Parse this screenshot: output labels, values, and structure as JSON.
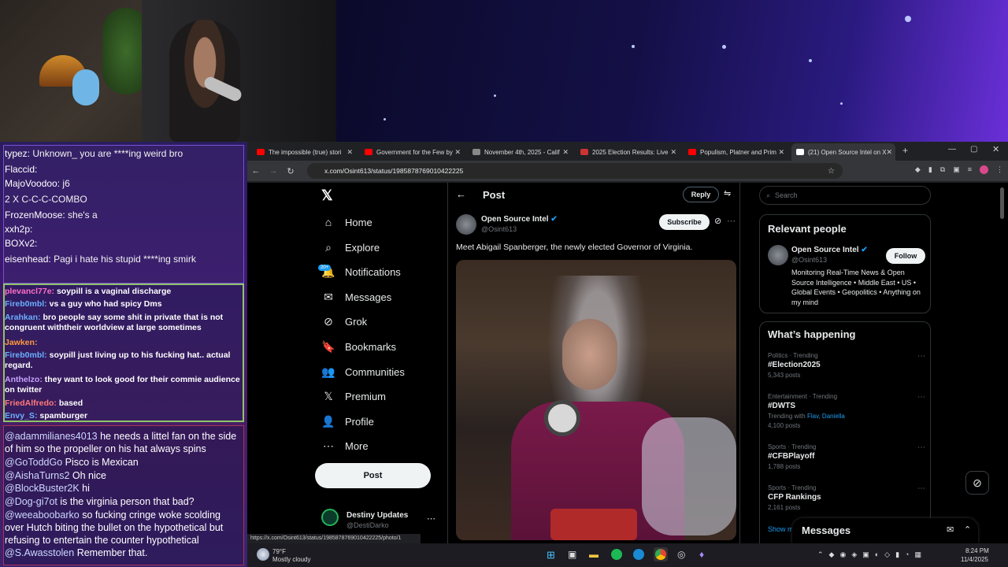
{
  "chat": {
    "top_lines": [
      {
        "user": "typez:",
        "text": "Unknown_ you are ****ing weird bro"
      },
      {
        "user": "Flaccid:",
        "text": ""
      },
      {
        "user": "MajoVoodoo:",
        "text": "j6"
      },
      {
        "user": "",
        "text": "2 X  C-C-C-COMBO"
      },
      {
        "user": "FrozenMoose:",
        "text": "she's a"
      },
      {
        "user": "xxh2p:",
        "text": ""
      },
      {
        "user": "BOXv2:",
        "text": ""
      },
      {
        "user": "eisenhead:",
        "text": "Pagi i hate his stupid ****ing smirk"
      }
    ],
    "mid_lines": [
      {
        "user": "plevancl77e:",
        "text": "soypill is a vaginal discharge"
      },
      {
        "user": "Fireb0mbl:",
        "text": "vs a guy who had spicy Dms"
      },
      {
        "user": "Arahkan:",
        "text": "bro people say some shit in private that is not congruent withtheir worldview at large sometimes"
      },
      {
        "user": "Jawken:",
        "text": ""
      },
      {
        "user": "Fireb0mbl:",
        "text": "soypill just living up to his fucking hat.. actual regard."
      },
      {
        "user": "Anthelzo:",
        "text": "they want to look good for their commie audience on twitter"
      },
      {
        "user": "FriedAlfredo:",
        "text": "based"
      },
      {
        "user": "Envy_S:",
        "text": "spamburger"
      }
    ],
    "bottom_lines": [
      {
        "user": "@adammilianes4013",
        "text": "he needs a littel fan on the side of him so the propeller on his hat always spins"
      },
      {
        "user": "@GoToddGo",
        "text": "Pisco is Mexican"
      },
      {
        "user": "@AishaTurns2",
        "text": "Oh nice"
      },
      {
        "user": "@BlockBuster2K",
        "text": "hi"
      },
      {
        "user": "@Dog-gi7ot",
        "text": "is the virginia person that bad?"
      },
      {
        "user": "@weeaboobarko",
        "text": "so fucking cringe woke scolding over Hutch biting the bullet on the hypothetical but refusing to entertain the counter hypothetical"
      },
      {
        "user": "@S.Awasstolen",
        "text": "Remember that."
      }
    ]
  },
  "browser": {
    "tabs": [
      {
        "label": "The impossible (true) stori",
        "color": "#ff0000"
      },
      {
        "label": "Government for the Few by",
        "color": "#ff0000"
      },
      {
        "label": "November 4th, 2025 - Calif",
        "color": "#888888"
      },
      {
        "label": "2025 Election Results: Live",
        "color": "#cc3333"
      },
      {
        "label": "Populism, Platner and Prim",
        "color": "#ff0000"
      },
      {
        "label": "(21) Open Source Intel on X",
        "color": "#ffffff"
      }
    ],
    "url": "x.com/Osint613/status/1985878769010422225",
    "status_url": "https://x.com/Osint613/status/1985878769010422225/photo/1"
  },
  "x": {
    "nav": [
      {
        "label": "Home",
        "icon": "⌂"
      },
      {
        "label": "Explore",
        "icon": "⌕"
      },
      {
        "label": "Notifications",
        "icon": "🔔"
      },
      {
        "label": "Messages",
        "icon": "✉"
      },
      {
        "label": "Grok",
        "icon": "⊘"
      },
      {
        "label": "Bookmarks",
        "icon": "🔖"
      },
      {
        "label": "Communities",
        "icon": "👥"
      },
      {
        "label": "Premium",
        "icon": "𝕏"
      },
      {
        "label": "Profile",
        "icon": "👤"
      },
      {
        "label": "More",
        "icon": "⋯"
      }
    ],
    "notif_badge": "20+",
    "post_button": "Post",
    "account_name": "Destiny Updates",
    "account_handle": "@DestiDarko",
    "header_title": "Post",
    "reply_button": "Reply",
    "author_name": "Open Source Intel",
    "author_handle": "@Osint613",
    "subscribe_button": "Subscribe",
    "tweet_text": "Meet Abigail Spanberger, the newly elected Governor of Virginia.",
    "search_placeholder": "Search",
    "relevant_title": "Relevant people",
    "relevant_name": "Open Source Intel",
    "relevant_handle": "@Osint613",
    "follow_button": "Follow",
    "relevant_bio": "Monitoring Real-Time News & Open Source Intelligence • Middle East • US • Global Events • Geopolitics • Anything on my mind",
    "happening_title": "What’s happening",
    "trends": [
      {
        "kicker": "Politics · Trending",
        "title": "#Election2025",
        "count": "5,343 posts"
      },
      {
        "kicker": "Entertainment · Trending",
        "title": "#DWTS",
        "count": "4,100 posts",
        "with": "Trending with ",
        "with_names": "Flav, Daniella"
      },
      {
        "kicker": "Sports · Trending",
        "title": "#CFBPlayoff",
        "count": "1,788 posts"
      },
      {
        "kicker": "Sports · Trending",
        "title": "CFP Rankings",
        "count": "2,161 posts"
      }
    ],
    "show_more": "Show m",
    "messages_dock": "Messages"
  },
  "taskbar": {
    "weather_temp": "79°F",
    "weather_desc": "Mostly cloudy",
    "time": "8:24 PM",
    "date": "11/4/2025"
  },
  "colors": {
    "accent": "#1d9bf0",
    "verified": "#1d9bf0"
  }
}
